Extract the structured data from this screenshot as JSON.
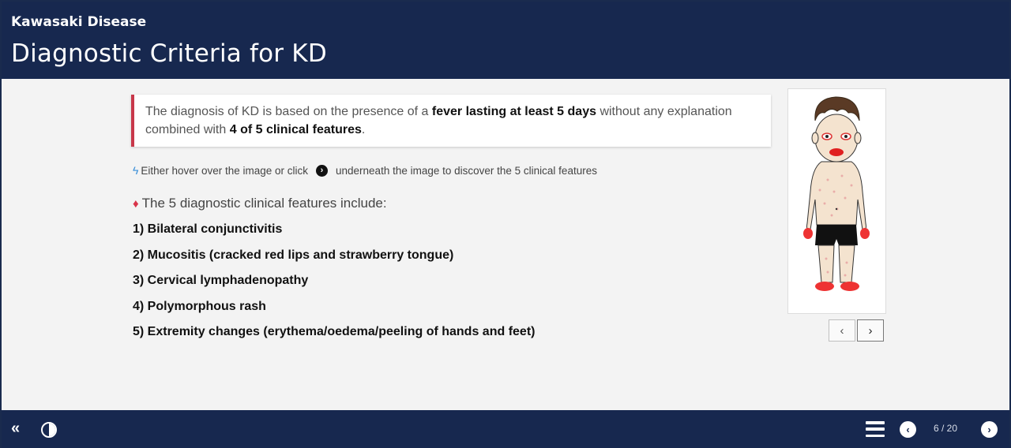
{
  "header": {
    "course_title": "Kawasaki Disease",
    "page_title": "Diagnostic Criteria for KD"
  },
  "callout": {
    "part1": "The diagnosis of KD is based on the presence of a ",
    "bold1": "fever lasting at least 5 days",
    "part2": " without any explanation combined with ",
    "bold2": "4 of 5 clinical features",
    "part3": "."
  },
  "hint": {
    "before": "Either hover over the image or click",
    "after": "underneath the image to discover the 5 clinical features",
    "bolt_icon": "lightning-icon",
    "arrow_icon": "circle-arrow-right-icon"
  },
  "intro": {
    "text": "The 5 diagnostic clinical features include:",
    "icon": "diamond-icon"
  },
  "features": [
    "1) Bilateral conjunctivitis",
    "2) Mucositis (cracked red lips and strawberry tongue)",
    "3) Cervical lymphadenopathy",
    "4) Polymorphous rash",
    "5) Extremity changes (erythema/oedema/peeling of hands and feet)"
  ],
  "image_nav": {
    "prev": "‹",
    "next": "›"
  },
  "footer": {
    "collapse": "«",
    "page_indicator": "6 / 20",
    "prev": "‹",
    "next": "›"
  },
  "colors": {
    "navy": "#17284f",
    "accent_red": "#c8384a",
    "bolt_blue": "#3a8fd8"
  }
}
